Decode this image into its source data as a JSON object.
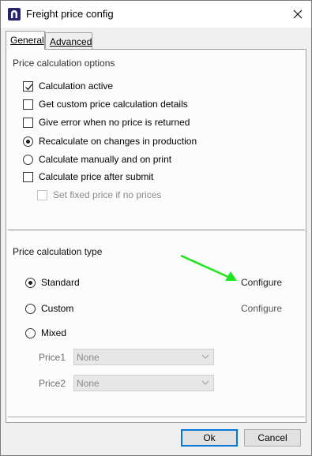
{
  "window": {
    "title": "Freight price config"
  },
  "tabs": [
    {
      "label": "General",
      "active": true
    },
    {
      "label": "Advanced",
      "active": false
    }
  ],
  "options_section": {
    "label": "Price calculation options",
    "checkboxes": [
      {
        "label": "Calculation active",
        "checked": true,
        "enabled": true
      },
      {
        "label": "Get custom price calculation details",
        "checked": false,
        "enabled": true
      },
      {
        "label": "Give error when no price is returned",
        "checked": false,
        "enabled": true
      }
    ],
    "radios": [
      {
        "label": "Recalculate on changes in production",
        "selected": true
      },
      {
        "label": "Calculate manually and on print",
        "selected": false
      }
    ],
    "submit_checkbox": {
      "label": "Calculate price after submit",
      "checked": false,
      "enabled": true
    },
    "fixed_price_checkbox": {
      "label": "Set fixed price if no prices",
      "checked": false,
      "enabled": false
    }
  },
  "type_section": {
    "label": "Price calculation type",
    "options": [
      {
        "label": "Standard",
        "selected": true,
        "configure_label": "Configure",
        "configure_enabled": true
      },
      {
        "label": "Custom",
        "selected": false,
        "configure_label": "Configure",
        "configure_enabled": false
      },
      {
        "label": "Mixed",
        "selected": false
      }
    ],
    "price1": {
      "label": "Price1",
      "value": "None"
    },
    "price2": {
      "label": "Price2",
      "value": "None"
    }
  },
  "footer": {
    "ok_label": "Ok",
    "cancel_label": "Cancel"
  },
  "colors": {
    "annotation_arrow": "#1ee61e",
    "focus_border": "#0078d7",
    "app_icon": "#26246a"
  }
}
